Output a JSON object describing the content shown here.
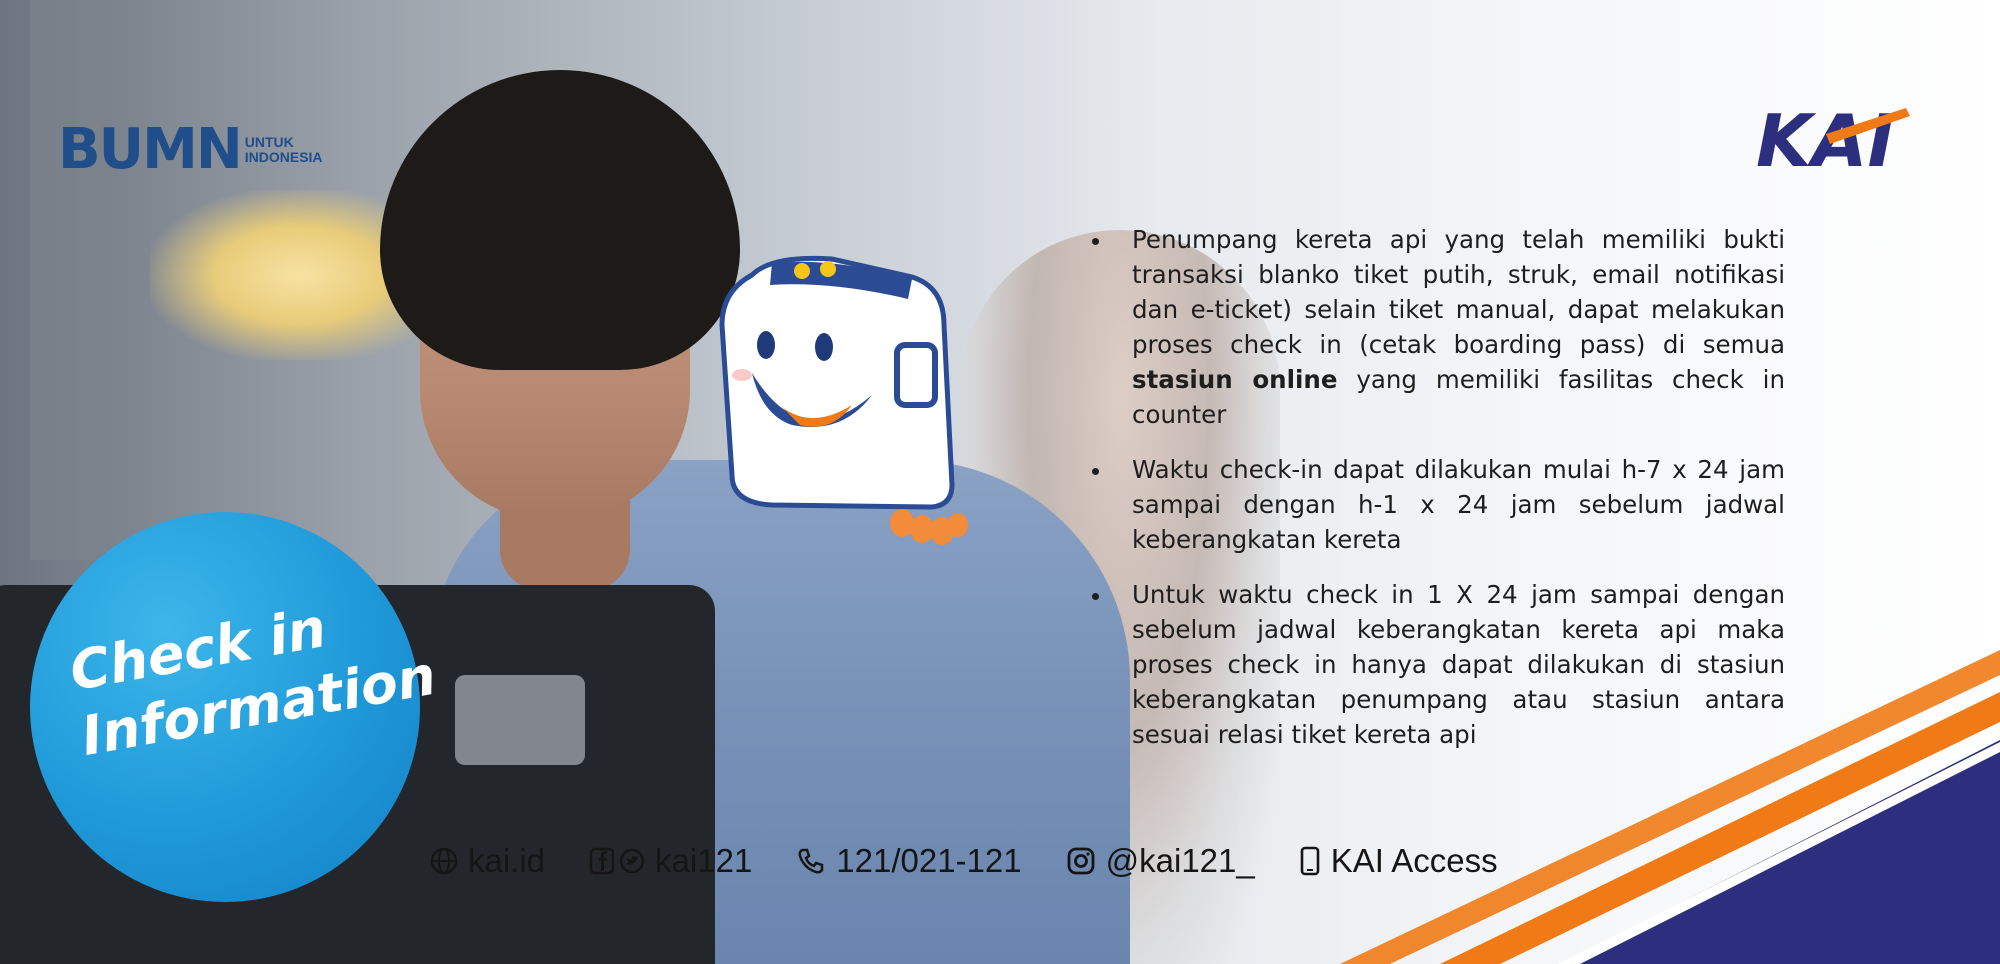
{
  "brand": {
    "bumn_logo_text": "BUMN",
    "bumn_logo_subtitle_line1": "UNTUK",
    "bumn_logo_subtitle_line2": "INDONESIA",
    "kai_logo_text": "KAI"
  },
  "badge": {
    "line1": "Check in",
    "line2": "Information"
  },
  "info_points": [
    {
      "text_before": "Penumpang kereta api yang telah memiliki bukti transaksi blanko tiket putih, struk, email notifikasi dan e-ticket) selain tiket manual, dapat melakukan proses check in (cetak boarding pass) di semua ",
      "text_bold": "stasiun online",
      "text_after": " yang memiliki fasilitas check in counter"
    },
    {
      "text_before": "Waktu check-in dapat dilakukan mulai h-7 x 24 jam sampai dengan h-1 x 24 jam sebelum jadwal keberangkatan kereta",
      "text_bold": "",
      "text_after": ""
    },
    {
      "text_before": "Untuk waktu check in 1 X 24 jam sampai dengan sebelum jadwal keberangkatan kereta api maka proses check in hanya dapat dilakukan di stasiun keberangkatan penumpang atau stasiun antara sesuai relasi tiket kereta api",
      "text_bold": "",
      "text_after": ""
    }
  ],
  "contacts": {
    "website": "kai.id",
    "social": "kai121",
    "phone": "121/021-121",
    "instagram": "@kai121_",
    "app": "KAI Access"
  },
  "colors": {
    "navy": "#2b2f7d",
    "orange": "#f07b16",
    "badge_blue": "#1f98d8",
    "bumn_blue": "#1f4e8a",
    "bumn_light": "#2aa3dc"
  },
  "icons": [
    "globe-icon",
    "facebook-icon",
    "twitter-icon",
    "phone-icon",
    "instagram-icon",
    "smartphone-icon"
  ]
}
